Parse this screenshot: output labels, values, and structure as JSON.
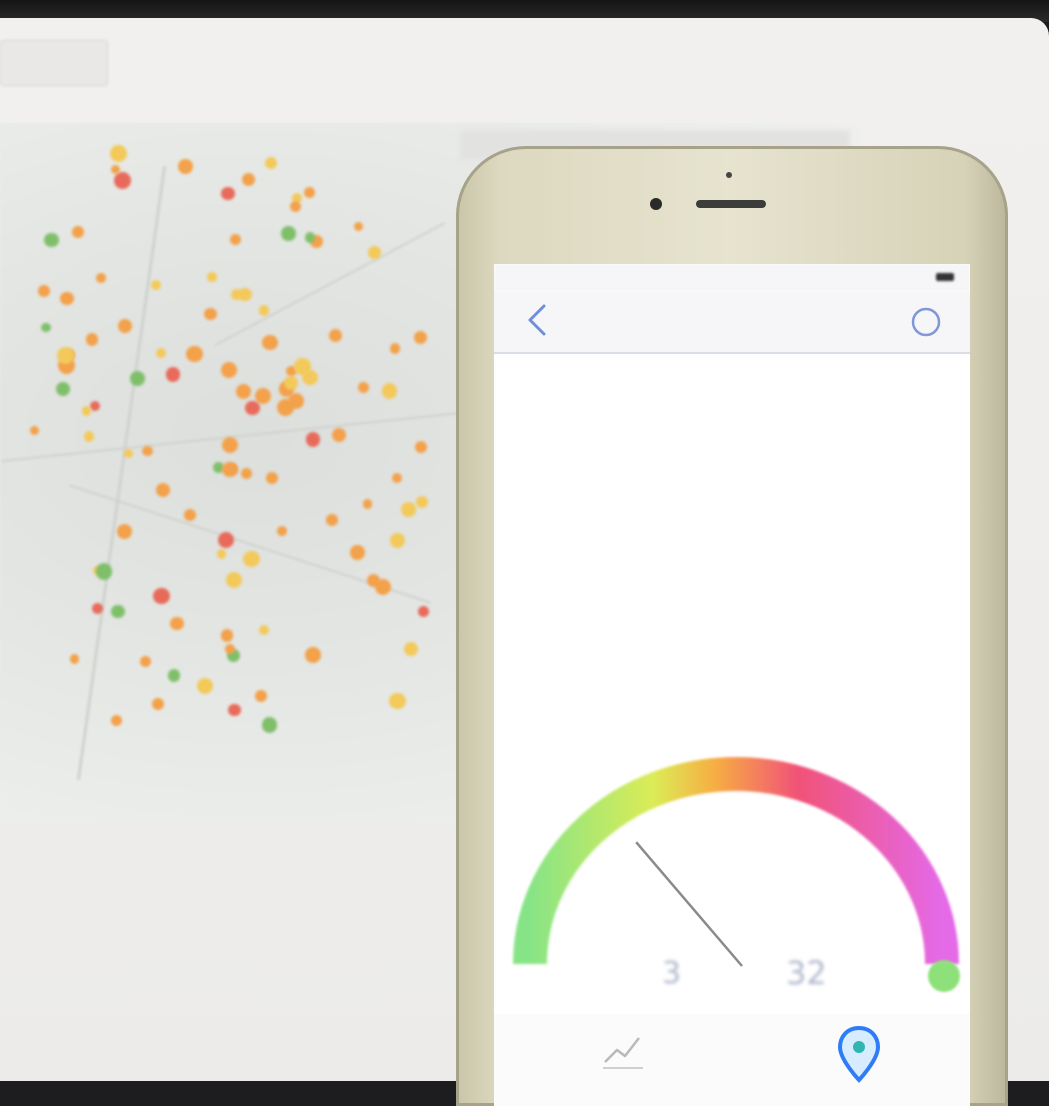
{
  "monitor": {
    "corner_chip_text": "",
    "dot_colors": {
      "orange": "#f3a14a",
      "yellow": "#f3c95a",
      "green": "#7fbf6a",
      "red": "#e86a5a"
    }
  },
  "phone": {
    "statusbar": {
      "carrier": "",
      "time": "",
      "battery": ""
    },
    "navbar": {
      "back_icon": "chevron-left-icon",
      "title": "",
      "refresh_icon": "circle-refresh-icon"
    },
    "timestamp": "",
    "readings_text": "",
    "gauge": {
      "center_text": "",
      "needle_level": 0.3,
      "scale_colors": [
        "#7be27a",
        "#e8e64a",
        "#f6a52e",
        "#f0406a",
        "#e25ae6"
      ]
    },
    "stats": {
      "left_label": "",
      "value_a": "3",
      "unit_a": "",
      "value_b": "32",
      "unit_b": "",
      "status_color": "#8ee17a"
    },
    "tabbar": {
      "chart_icon": "line-chart-icon",
      "chart_label": "",
      "map_icon": "location-pin-icon",
      "accent": "#2f7df6"
    }
  }
}
